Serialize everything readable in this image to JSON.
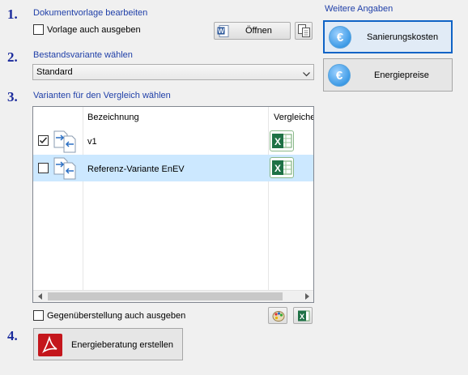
{
  "steps": [
    "1.",
    "2.",
    "3.",
    "4."
  ],
  "section1": {
    "title": "Dokumentvorlage bearbeiten",
    "checkbox_label": "Vorlage auch ausgeben",
    "checkbox_checked": false,
    "open_button": "Öffnen",
    "copy_icon": "copy-document-icon",
    "word_icon": "word-document-icon"
  },
  "section2": {
    "title": "Bestandsvariante wählen",
    "select_value": "Standard"
  },
  "section3": {
    "title": "Varianten für den Vergleich wählen",
    "columns": [
      "Bezeichnung",
      "Vergleiche"
    ],
    "rows": [
      {
        "checked": true,
        "label": "v1"
      },
      {
        "checked": false,
        "label": "Referenz-Variante EnEV"
      }
    ],
    "compare_checkbox_label": "Gegenüberstellung auch ausgeben",
    "compare_checkbox_checked": false
  },
  "section4": {
    "create_button": "Energieberatung erstellen",
    "pdf_icon": "pdf-icon"
  },
  "right_panel": {
    "title": "Weitere Angaben",
    "buttons": [
      "Sanierungskosten",
      "Energiepreise"
    ],
    "euro_symbol": "€"
  },
  "colors": {
    "step_number": "#1a2a9c",
    "section_label": "#1f3fa8",
    "selected_row": "#cce8ff",
    "focus_border": "#0f63c6"
  }
}
